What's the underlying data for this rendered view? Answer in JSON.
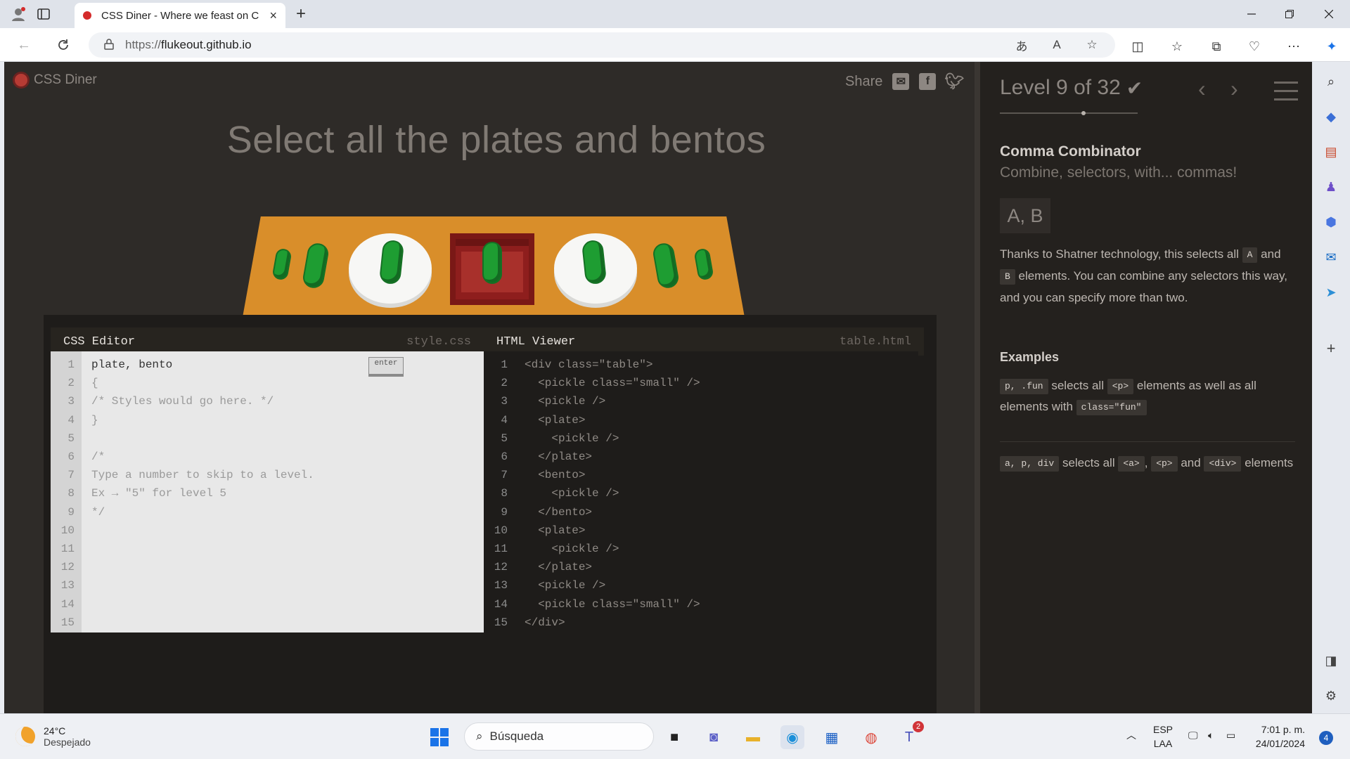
{
  "browser": {
    "tab_title": "CSS Diner - Where we feast on C",
    "url_prefix": "https://",
    "url_host": "flukeout.github.io",
    "new_tab_symbol": "+",
    "close_symbol": "×"
  },
  "game": {
    "logo": "CSS Diner",
    "share": "Share",
    "order": "Select all the plates and bentos",
    "css_editor": {
      "title": "CSS Editor",
      "file": "style.css",
      "enter_label": "enter",
      "line_numbers": [
        "1",
        "2",
        "3",
        "4",
        "5",
        "6",
        "7",
        "8",
        "9",
        "10",
        "11",
        "12",
        "13",
        "14",
        "15"
      ],
      "lines": [
        "plate, bento",
        "{",
        "/* Styles would go here. */",
        "}",
        "",
        "/*",
        "Type a number to skip to a level.",
        "Ex → \"5\" for level 5",
        "*/"
      ]
    },
    "html_viewer": {
      "title": "HTML Viewer",
      "file": "table.html",
      "line_numbers": [
        "1",
        "2",
        "3",
        "4",
        "5",
        "6",
        "7",
        "8",
        "9",
        "10",
        "11",
        "12",
        "13",
        "14",
        "15"
      ],
      "lines": [
        "<div class=\"table\">",
        "  <pickle class=\"small\" />",
        "  <pickle />",
        "  <plate>",
        "    <pickle />",
        "  </plate>",
        "  <bento>",
        "    <pickle />",
        "  </bento>",
        "  <plate>",
        "    <pickle />",
        "  </plate>",
        "  <pickle />",
        "  <pickle class=\"small\" />",
        "</div>"
      ]
    }
  },
  "level": {
    "title": "Level 9 of 32",
    "check": "✔",
    "selector_name": "Comma Combinator",
    "selector_title": "Combine, selectors, with... commas!",
    "syntax": "A, B",
    "hint_part1": "Thanks to Shatner technology, this selects all",
    "hint_tag_a": "A",
    "hint_and": "and",
    "hint_tag_b": "B",
    "hint_part2": "elements. You can combine any selectors this way, and you can specify more than two.",
    "examples_title": "Examples",
    "example1": {
      "code": "p, .fun",
      "text1": "selects all",
      "tag": "<p>",
      "text2": "elements as well as all elements with",
      "tag2": "class=\"fun\""
    },
    "example2": {
      "code": "a, p, div",
      "text1": "selects all",
      "tag_a": "<a>",
      "comma": ",",
      "tag_p": "<p>",
      "and": "and",
      "tag_div": "<div>",
      "text2": "elements"
    }
  },
  "taskbar": {
    "temp": "24°C",
    "weather": "Despejado",
    "search": "Búsqueda",
    "lang1": "ESP",
    "lang2": "LAA",
    "time": "7:01 p. m.",
    "date": "24/01/2024",
    "teams_badge": "2",
    "notifications": "4"
  }
}
